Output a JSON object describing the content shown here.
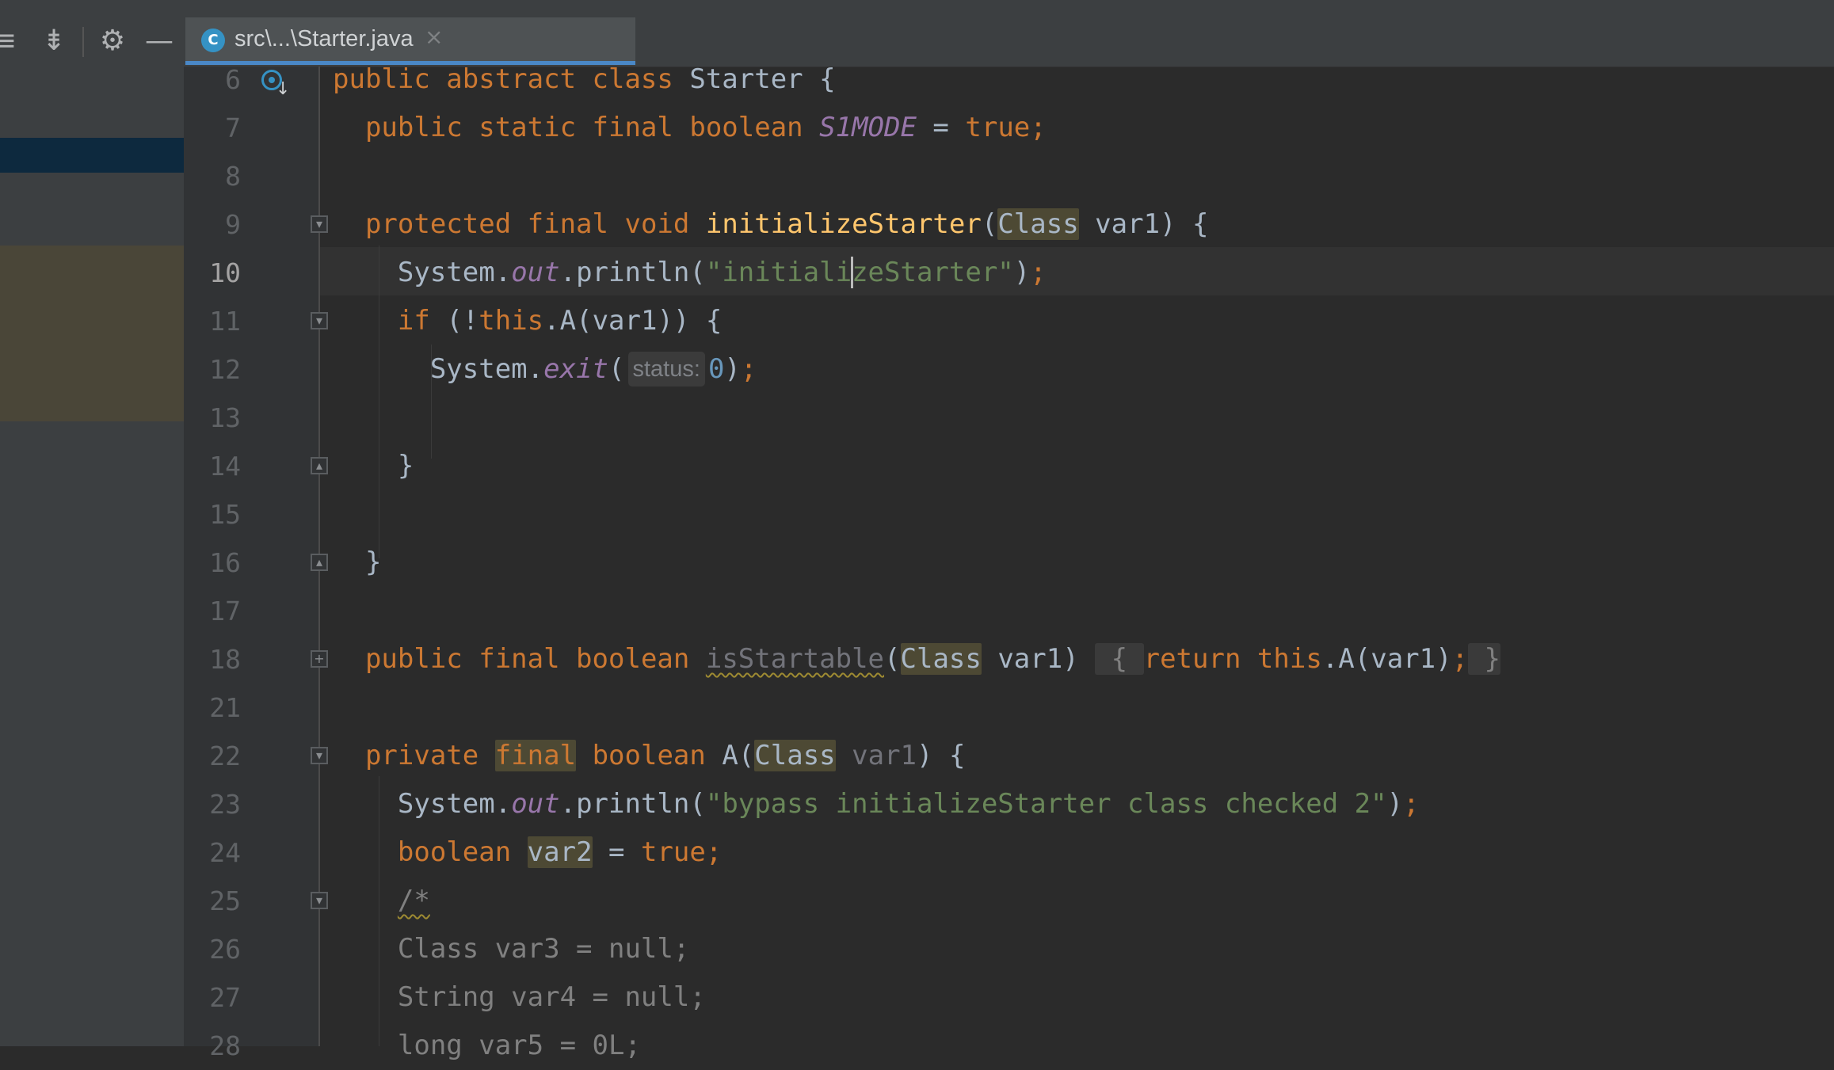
{
  "toolbar": {
    "buttons": [
      {
        "name": "expand-all-icon",
        "glyph": "≡"
      },
      {
        "name": "collapse-all-icon",
        "glyph": "⇟"
      },
      {
        "name": "gear-icon",
        "glyph": "⚙"
      },
      {
        "name": "minimize-icon",
        "glyph": "—"
      }
    ]
  },
  "tab": {
    "icon_letter": "C",
    "label": "src\\...\\Starter.java",
    "close_glyph": "×"
  },
  "editor": {
    "current_line": "10",
    "lines": [
      {
        "num": "6"
      },
      {
        "num": "7"
      },
      {
        "num": "8"
      },
      {
        "num": "9"
      },
      {
        "num": "10"
      },
      {
        "num": "11"
      },
      {
        "num": "12"
      },
      {
        "num": "13"
      },
      {
        "num": "14"
      },
      {
        "num": "15"
      },
      {
        "num": "16"
      },
      {
        "num": "17"
      },
      {
        "num": "18"
      },
      {
        "num": "21"
      },
      {
        "num": "22"
      },
      {
        "num": "23"
      },
      {
        "num": "24"
      },
      {
        "num": "25"
      },
      {
        "num": "26"
      },
      {
        "num": "27"
      },
      {
        "num": "28"
      }
    ],
    "code": {
      "l6_kw": "public abstract class",
      "l6_name": " Starter {",
      "l7_kw": "public static final boolean",
      "l7_const": "S1MODE",
      "l7_eq": " = ",
      "l7_true": "true",
      "l7_semi": ";",
      "l9_kw": "protected final void",
      "l9_fn": "initializeStarter",
      "l9_open": "(",
      "l9_class": "Class",
      "l9_rest": " var1) {",
      "l10_sys": "System.",
      "l10_out": "out",
      "l10_call": ".println(",
      "l10_str_a": "\"initiali",
      "l10_str_b": "zeStarter\"",
      "l10_close": ")",
      "l10_semi": ";",
      "l11_if": "if",
      "l11_open": " (!",
      "l11_this": "this",
      "l11_rest": ".A(var1)) {",
      "l12_sys": "System.",
      "l12_exit": "exit",
      "l12_open": "(",
      "l12_hint": "status:",
      "l12_zero": "0",
      "l12_close": ")",
      "l12_semi": ";",
      "l14_brace": "}",
      "l16_brace": "}",
      "l18_kw": "public final boolean",
      "l18_fn": "isStartable",
      "l18_open": "(",
      "l18_class": "Class",
      "l18_args": " var1) ",
      "l18_lb": "{",
      "l18_return": "return",
      "l18_this": "this",
      "l18_call": ".A(var1)",
      "l18_semi": ";",
      "l18_rb": "}",
      "l22_private": "private",
      "l22_final": "final",
      "l22_bool": "boolean",
      "l22_name": " A(",
      "l22_class": "Class",
      "l22_var": "var1",
      "l22_rest": ") {",
      "l23_sys": "System.",
      "l23_out": "out",
      "l23_call": ".println(",
      "l23_str": "\"bypass initializeStarter class checked 2\"",
      "l23_close": ")",
      "l23_semi": ";",
      "l24_bool": "boolean",
      "l24_var": "var2",
      "l24_eq": " = ",
      "l24_true": "true",
      "l24_semi": ";",
      "l25_cmt": "/*",
      "l26_cmt": "Class var3 = null;",
      "l27_cmt": "String var4 = null;",
      "l28_cmt": "long var5 = 0L;"
    }
  },
  "colors": {
    "keyword": "#cc7832",
    "method": "#ffc66d",
    "string": "#6a8759",
    "number": "#6897bb",
    "field": "#9876aa",
    "text": "#a9b7c6",
    "accent": "#4a88c7"
  }
}
